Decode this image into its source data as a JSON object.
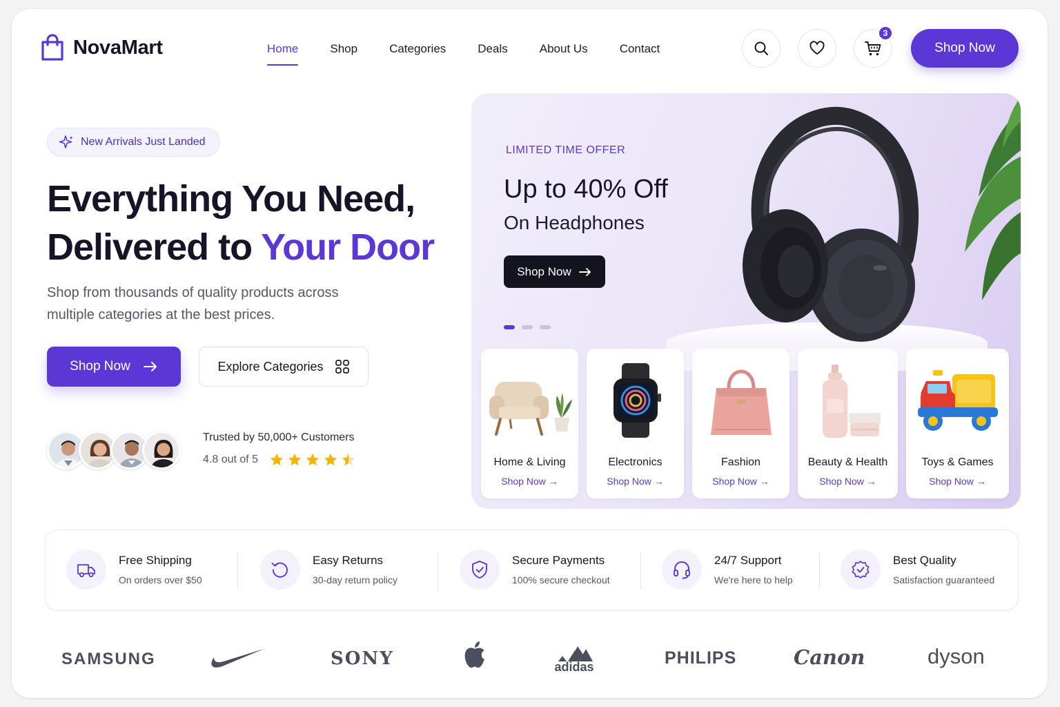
{
  "brand": {
    "name": "NovaMart"
  },
  "nav": {
    "links": [
      "Home",
      "Shop",
      "Categories",
      "Deals",
      "About Us",
      "Contact"
    ],
    "active": "Home",
    "cart_count": "3",
    "cta_label": "Shop Now"
  },
  "hero": {
    "badge": "New Arrivals Just Landed",
    "title_line1": "Everything You Need,",
    "title_line2_prefix": "Delivered to ",
    "title_line2_accent": "Your Door",
    "subtitle": "Shop from thousands of quality products across multiple categories at the best prices.",
    "primary_button": "Shop Now",
    "secondary_button": "Explore Categories",
    "trust_text": "Trusted by 50,000+ Customers",
    "rating_text": "4.8 out of 5",
    "rating_value": 4.8,
    "rating_max": 5
  },
  "promo": {
    "eyebrow": "LIMITED TIME OFFER",
    "title": "Up to 40% Off",
    "subtitle": "On Headphones",
    "button": "Shop Now",
    "slides": 3,
    "active_slide": 1
  },
  "categories": [
    {
      "name": "Home & Living",
      "link": "Shop Now",
      "icon": "armchair-icon"
    },
    {
      "name": "Electronics",
      "link": "Shop Now",
      "icon": "smartwatch-icon"
    },
    {
      "name": "Fashion",
      "link": "Shop Now",
      "icon": "handbag-icon"
    },
    {
      "name": "Beauty & Health",
      "link": "Shop Now",
      "icon": "cosmetics-icon"
    },
    {
      "name": "Toys & Games",
      "link": "Shop Now",
      "icon": "toy-truck-icon"
    }
  ],
  "features": [
    {
      "title": "Free Shipping",
      "sub": "On orders over $50",
      "icon": "truck-icon"
    },
    {
      "title": "Easy Returns",
      "sub": "30-day return policy",
      "icon": "return-icon"
    },
    {
      "title": "Secure Payments",
      "sub": "100% secure checkout",
      "icon": "shield-check-icon"
    },
    {
      "title": "24/7 Support",
      "sub": "We're here to help",
      "icon": "headset-icon"
    },
    {
      "title": "Best Quality",
      "sub": "Satisfaction guaranteed",
      "icon": "quality-badge-icon"
    }
  ],
  "brands": [
    "SAMSUNG",
    "Nike",
    "SONY",
    "Apple",
    "adidas",
    "PHILIPS",
    "Canon",
    "dyson"
  ],
  "colors": {
    "accent": "#5b37d6",
    "dark": "#14141f",
    "star": "#f5b400"
  }
}
